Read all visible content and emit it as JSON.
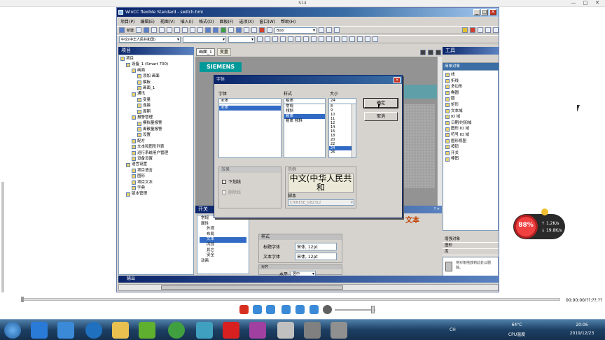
{
  "window": {
    "title": "S14"
  },
  "app": {
    "title": "WinCC flexible Standard - switch.hmi",
    "menu": [
      "项目(P)",
      "编辑(E)",
      "视图(V)",
      "插入(I)",
      "格式(O)",
      "面板(F)",
      "选项(X)",
      "窗口(W)",
      "帮助(H)"
    ],
    "toolbar": {
      "new_label": "新建",
      "tag_type": "Bool",
      "lang_select": "中文(中华人民共和国)"
    },
    "project_panel": {
      "title": "项目",
      "items": [
        {
          "label": "项目",
          "lvl": 0
        },
        {
          "label": "设备_1 (Smart 700)",
          "lvl": 1
        },
        {
          "label": "画面",
          "lvl": 2
        },
        {
          "label": "添加 画面",
          "lvl": 3
        },
        {
          "label": "模板",
          "lvl": 3
        },
        {
          "label": "画面_1",
          "lvl": 3
        },
        {
          "label": "通讯",
          "lvl": 2
        },
        {
          "label": "变量",
          "lvl": 3
        },
        {
          "label": "连接",
          "lvl": 3
        },
        {
          "label": "周期",
          "lvl": 3
        },
        {
          "label": "报警管理",
          "lvl": 2
        },
        {
          "label": "模拟量报警",
          "lvl": 3
        },
        {
          "label": "离散量报警",
          "lvl": 3
        },
        {
          "label": "设置",
          "lvl": 3
        },
        {
          "label": "配方",
          "lvl": 2
        },
        {
          "label": "文本和图形列表",
          "lvl": 2
        },
        {
          "label": "运行系统用户管理",
          "lvl": 2
        },
        {
          "label": "设备设置",
          "lvl": 2
        },
        {
          "label": "语言设置",
          "lvl": 1
        },
        {
          "label": "项目语言",
          "lvl": 2
        },
        {
          "label": "图形",
          "lvl": 2
        },
        {
          "label": "项目文本",
          "lvl": 2
        },
        {
          "label": "字典",
          "lvl": 2
        },
        {
          "label": "版本管理",
          "lvl": 1
        }
      ]
    },
    "tabs": [
      "画面_1",
      "变量"
    ],
    "brand": "SIEMENS",
    "tools_panel": {
      "title": "工具",
      "section": "简单对象",
      "items": [
        "线",
        "折线",
        "多边形",
        "椭圆",
        "圆",
        "矩形",
        "文本域",
        "IO 域",
        "日期/时间域",
        "图形 IO 域",
        "符号 IO 域",
        "图形视图",
        "按钮",
        "开关",
        "棒图"
      ],
      "extra": [
        "增强对象",
        "图形",
        "库"
      ],
      "drop_hint": "将对象拖放到此处以删除。"
    },
    "props_panel": {
      "title": "开关",
      "object": "文本",
      "tree": [
        "常规",
        "属性",
        "外观",
        "布局",
        "文本",
        "闪烁",
        "其它",
        "安全",
        "动画"
      ],
      "group_style": "样式",
      "font_label": "标题字体",
      "font_value": "宋体, 12pt",
      "textfont_label": "文本字体",
      "textfont_value": "宋体, 12pt",
      "align_group": "对齐",
      "align_label": "水平",
      "align_value": "居中"
    },
    "output_label": "输出"
  },
  "dialog": {
    "title": "字体",
    "font_label": "字体",
    "fonts": [
      "宋体",
      "宋体"
    ],
    "style_label": "样式",
    "styles": [
      "粗体",
      "常规",
      "倾斜",
      "粗体",
      "粗体 倾斜"
    ],
    "size_label": "大小",
    "size_value": "24",
    "sizes": [
      "8",
      "9",
      "10",
      "11",
      "12",
      "14",
      "16",
      "18",
      "20",
      "22",
      "24",
      "26"
    ],
    "ok": "确定",
    "cancel": "取消",
    "effects_label": "效果",
    "underline": "下划线",
    "strike": "删除线",
    "sample_label": "示例",
    "sample_text": "中文(中华人民共和",
    "script_label": "脚本",
    "script_value": "CHINESE_GB2312"
  },
  "player": {
    "time": "00:00:00/??:??:??"
  },
  "speed": {
    "percent": "88%",
    "up": "1.2K/s",
    "down": "19.8K/s"
  },
  "tray": {
    "temp": "64°C",
    "cpu": "CPU温度",
    "time": "20:06",
    "date": "2019/12/23",
    "ch": "CH"
  }
}
